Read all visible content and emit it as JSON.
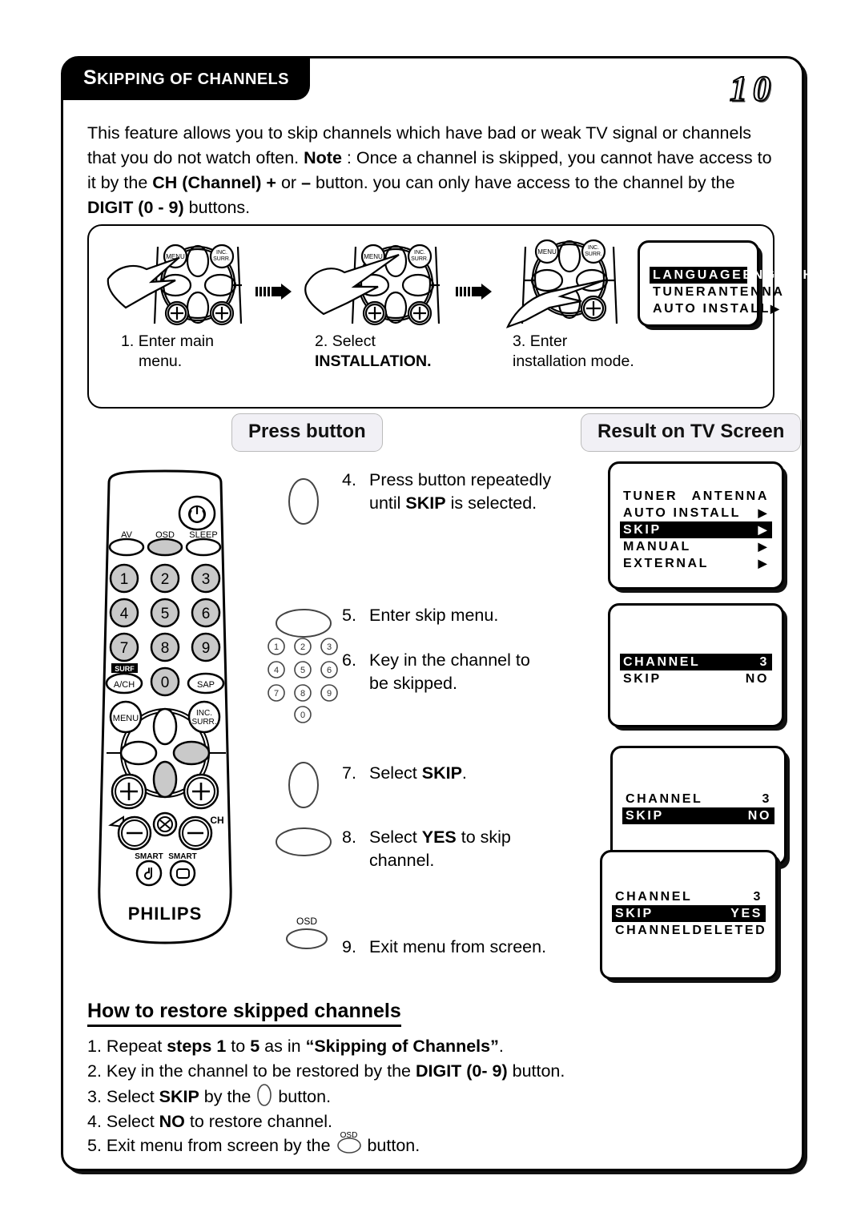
{
  "page": {
    "title_first_letter": "S",
    "title_rest": "KIPPING OF CHANNELS",
    "page_number": "10"
  },
  "intro": {
    "part1": "This feature allows you to skip channels which have bad or weak TV signal or channels that you do not watch often. ",
    "note_label": "Note",
    "part2": " : Once a channel is skipped, you cannot have access to it by the ",
    "ch_label": "CH (Channel)",
    "part3": " ",
    "plus": "+",
    "part4": " or ",
    "minus": "–",
    "part5": " button. you can only have access to the channel by the ",
    "digit_label": "DIGIT (0 - 9)",
    "part6": " buttons."
  },
  "top_steps": [
    {
      "num": "1.",
      "line1": "Enter main",
      "line2": "menu.",
      "bold2": ""
    },
    {
      "num": "2.",
      "line1": "Select",
      "line2": "",
      "bold2": "INSTALLATION."
    },
    {
      "num": "3.",
      "line1": "Enter",
      "line2": "installation mode.",
      "bold2": ""
    }
  ],
  "banners": {
    "press_button": "Press button",
    "result_on_tv": "Result on TV Screen"
  },
  "remote": {
    "brand": "PHILIPS",
    "labels": {
      "av": "AV",
      "osd": "OSD",
      "sleep": "SLEEP",
      "surf": "SURF",
      "a_ch": "A/CH",
      "sap": "SAP",
      "menu": "MENU",
      "inc": "INC.",
      "surr": "SURR.",
      "ch": "CH",
      "smart1": "SMART",
      "smart2": "SMART"
    },
    "digits": [
      "1",
      "2",
      "3",
      "4",
      "5",
      "6",
      "7",
      "8",
      "9",
      "0"
    ]
  },
  "instructions": [
    {
      "num": "4.",
      "line1_a": "Press button repeatedly",
      "line1_b": "",
      "line2_a": "until ",
      "line2_bold": "SKIP",
      "line2_b": " is selected."
    },
    {
      "num": "5.",
      "line1_a": "Enter skip menu.",
      "line1_b": "",
      "line2_a": "",
      "line2_bold": "",
      "line2_b": ""
    },
    {
      "num": "6.",
      "line1_a": "Key in the channel  to",
      "line1_b": "",
      "line2_a": "be skipped.",
      "line2_bold": "",
      "line2_b": ""
    },
    {
      "num": "7.",
      "line1_a": "Select ",
      "line1_bold": "SKIP",
      "line1_b": ".",
      "line2_a": "",
      "line2_bold": "",
      "line2_b": ""
    },
    {
      "num": "8.",
      "line1_a": "Select ",
      "line1_bold": "YES",
      "line1_b": " to skip",
      "line2_a": "channel.",
      "line2_bold": "",
      "line2_b": ""
    },
    {
      "num": "9.",
      "line1_a": "Exit menu from screen.",
      "line1_b": "",
      "line2_a": "",
      "line2_bold": "",
      "line2_b": ""
    }
  ],
  "instr_glyph_labels": {
    "osd": "OSD"
  },
  "keypad_digits": [
    "1",
    "2",
    "3",
    "4",
    "5",
    "6",
    "7",
    "8",
    "9",
    "0"
  ],
  "tv_screens": [
    {
      "id": "screen-install",
      "rows": [
        {
          "label": "LANGUAGE",
          "value": "ENGLISH",
          "highlight": true,
          "arrow": false
        },
        {
          "label": "TUNER",
          "value": "ANTENNA",
          "highlight": false,
          "arrow": false
        },
        {
          "label": "AUTO INSTALL",
          "value": "",
          "highlight": false,
          "arrow": true
        }
      ]
    },
    {
      "id": "screen-skip-menu",
      "rows": [
        {
          "label": "TUNER",
          "value": "ANTENNA",
          "highlight": false,
          "arrow": false
        },
        {
          "label": "AUTO INSTALL",
          "value": "",
          "highlight": false,
          "arrow": true
        },
        {
          "label": "SKIP",
          "value": "",
          "highlight": true,
          "arrow": true
        },
        {
          "label": "MANUAL",
          "value": "",
          "highlight": false,
          "arrow": true
        },
        {
          "label": "EXTERNAL",
          "value": "",
          "highlight": false,
          "arrow": true
        }
      ]
    },
    {
      "id": "screen-channel-no",
      "rows": [
        {
          "label": "CHANNEL",
          "value": "3",
          "highlight": true,
          "arrow": false
        },
        {
          "label": "SKIP",
          "value": "NO",
          "highlight": false,
          "arrow": false
        }
      ]
    },
    {
      "id": "screen-skip-no",
      "rows": [
        {
          "label": "CHANNEL",
          "value": "3",
          "highlight": false,
          "arrow": false
        },
        {
          "label": "SKIP",
          "value": "NO",
          "highlight": true,
          "arrow": false
        }
      ]
    },
    {
      "id": "screen-skip-yes",
      "rows": [
        {
          "label": "CHANNEL",
          "value": "3",
          "highlight": false,
          "arrow": false
        },
        {
          "label": "SKIP",
          "value": "YES",
          "highlight": true,
          "arrow": false
        },
        {
          "label": "CHANNEL",
          "value": "DELETED",
          "highlight": false,
          "arrow": false
        }
      ]
    }
  ],
  "restore": {
    "title": "How to restore skipped channels",
    "items": [
      {
        "num": "1.",
        "a": " Repeat ",
        "b1": "steps 1",
        "c": " to ",
        "b2": "5",
        "d": " as in ",
        "b3": "“Skipping of Channels”",
        "e": "."
      },
      {
        "num": "2.",
        "a": " Key in the channel to be restored by the ",
        "b1": "DIGIT (0- 9)",
        "c": " button.",
        "b2": "",
        "d": "",
        "b3": "",
        "e": ""
      },
      {
        "num": "3.",
        "a": " Select ",
        "b1": "SKIP",
        "c": " by the ",
        "glyph": "cursor-button",
        "d": " button.",
        "b2": "",
        "b3": "",
        "e": ""
      },
      {
        "num": "4.",
        "a": " Select ",
        "b1": "NO",
        "c": " to restore channel.",
        "b2": "",
        "d": "",
        "b3": "",
        "e": ""
      },
      {
        "num": "5.",
        "a": " Exit menu from screen by the ",
        "b1": "",
        "c": "",
        "glyph": "osd-button",
        "glyph_label": "OSD",
        "d": " button.",
        "b2": "",
        "b3": "",
        "e": ""
      }
    ]
  },
  "colors": {
    "ink": "#000000",
    "banner_bg": "#f1f0f5",
    "key_gray": "#c9c9c9"
  }
}
